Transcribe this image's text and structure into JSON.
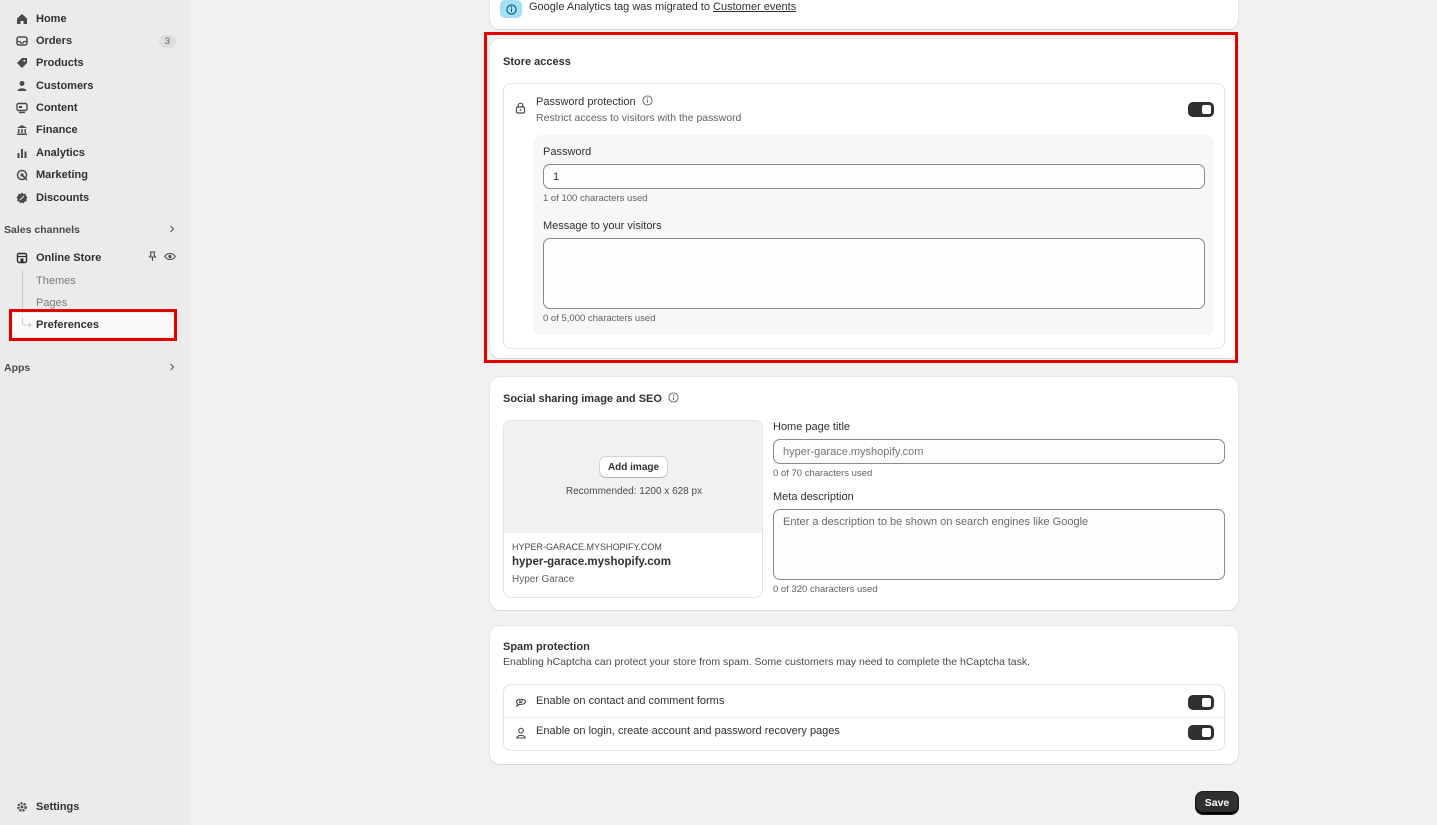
{
  "sidebar": {
    "items": [
      {
        "label": "Home",
        "icon": "home-icon"
      },
      {
        "label": "Orders",
        "icon": "inbox-icon",
        "badge": "3"
      },
      {
        "label": "Products",
        "icon": "tag-icon"
      },
      {
        "label": "Customers",
        "icon": "person-icon"
      },
      {
        "label": "Content",
        "icon": "content-icon"
      },
      {
        "label": "Finance",
        "icon": "bank-icon"
      },
      {
        "label": "Analytics",
        "icon": "bar-chart-icon"
      },
      {
        "label": "Marketing",
        "icon": "target-icon"
      },
      {
        "label": "Discounts",
        "icon": "discount-icon"
      }
    ],
    "sales_channels_label": "Sales channels",
    "online_store": {
      "label": "Online Store",
      "subitems": [
        "Themes",
        "Pages",
        "Preferences"
      ]
    },
    "apps_label": "Apps",
    "settings_label": "Settings"
  },
  "banner": {
    "text": "Google Analytics tag was migrated to ",
    "link": "Customer events"
  },
  "store_access": {
    "title": "Store access",
    "password_protection_label": "Password protection",
    "password_protection_desc": "Restrict access to visitors with the password",
    "password_label": "Password",
    "password_value": "1",
    "password_help": "1 of 100 characters used",
    "message_label": "Message to your visitors",
    "message_value": "",
    "message_help": "0 of 5,000 characters used"
  },
  "seo": {
    "title": "Social sharing image and SEO",
    "add_image_label": "Add image",
    "recommended": "Recommended: 1200 x 628 px",
    "preview_domain_caps": "HYPER-GARACE.MYSHOPIFY.COM",
    "preview_domain": "hyper-garace.myshopify.com",
    "preview_store": "Hyper Garace",
    "home_title_label": "Home page title",
    "home_title_placeholder": "hyper-garace.myshopify.com",
    "home_title_help": "0 of 70 characters used",
    "meta_label": "Meta description",
    "meta_placeholder": "Enter a description to be shown on search engines like Google",
    "meta_help": "0 of 320 characters used"
  },
  "spam": {
    "title": "Spam protection",
    "desc": "Enabling hCaptcha can protect your store from spam. Some customers may need to complete the hCaptcha task.",
    "contact_label": "Enable on contact and comment forms",
    "login_label": "Enable on login, create account and password recovery pages"
  },
  "save_label": "Save"
}
